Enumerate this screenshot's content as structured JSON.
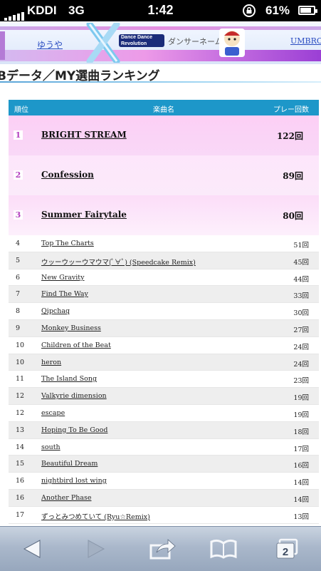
{
  "status": {
    "carrier": "KDDI",
    "network": "3G",
    "time": "1:42",
    "battery": "61%"
  },
  "header": {
    "username": "ゆうや",
    "logo_text": "Dance Dance Revolution",
    "dancer_name_label": "ダンサーネーム",
    "umbro_link": "UMBRO!"
  },
  "page_title": "Bデータ／MY選曲ランキング",
  "table": {
    "headers": {
      "rank": "順位",
      "song": "楽曲名",
      "plays": "プレー回数"
    },
    "top": [
      {
        "rank": "1",
        "song": "BRIGHT STREAM",
        "plays": "122回"
      },
      {
        "rank": "2",
        "song": "Confession",
        "plays": "89回"
      },
      {
        "rank": "3",
        "song": "Summer Fairytale",
        "plays": "80回"
      }
    ],
    "rows": [
      {
        "rank": "4",
        "song": "Top The Charts",
        "plays": "51回"
      },
      {
        "rank": "5",
        "song": "ウッーウッーウマウマ(ﾟ∀ﾟ) (Speedcake Remix)",
        "plays": "45回"
      },
      {
        "rank": "6",
        "song": "New Gravity",
        "plays": "44回"
      },
      {
        "rank": "7",
        "song": "Find The Way",
        "plays": "33回"
      },
      {
        "rank": "8",
        "song": "Qipchaq",
        "plays": "30回"
      },
      {
        "rank": "9",
        "song": "Monkey Business",
        "plays": "27回"
      },
      {
        "rank": "10",
        "song": "Children of the Beat",
        "plays": "24回"
      },
      {
        "rank": "10",
        "song": "heron",
        "plays": "24回"
      },
      {
        "rank": "11",
        "song": "The Island Song",
        "plays": "23回"
      },
      {
        "rank": "12",
        "song": "Valkyrie dimension",
        "plays": "19回"
      },
      {
        "rank": "12",
        "song": "escape",
        "plays": "19回"
      },
      {
        "rank": "13",
        "song": "Hoping To Be Good",
        "plays": "18回"
      },
      {
        "rank": "14",
        "song": "south",
        "plays": "17回"
      },
      {
        "rank": "15",
        "song": "Beautiful Dream",
        "plays": "16回"
      },
      {
        "rank": "16",
        "song": "nightbird lost wing",
        "plays": "14回"
      },
      {
        "rank": "16",
        "song": "Another Phase",
        "plays": "14回"
      },
      {
        "rank": "17",
        "song": "ずっとみつめていて (Ryu☆Remix)",
        "plays": "13回"
      }
    ]
  },
  "toolbar": {
    "tab_count": "2"
  },
  "colors": {
    "header_blue": "#1d97c9",
    "top_pink": "#fccff5",
    "rank_purple": "#b33fbf"
  }
}
